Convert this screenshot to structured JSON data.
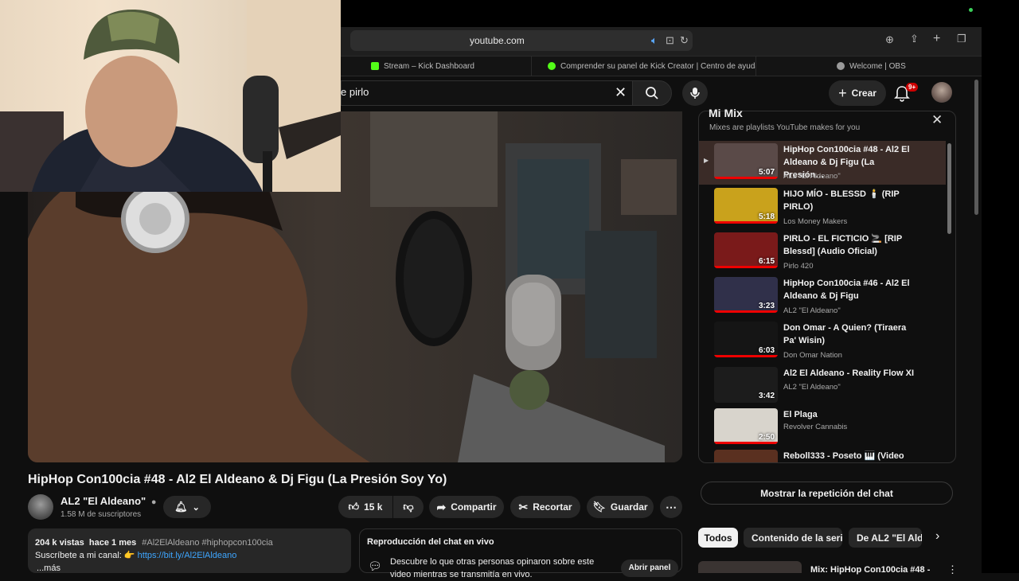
{
  "browser": {
    "url": "youtube.com",
    "tabs": [
      {
        "label": "Stream – Kick Dashboard",
        "color": "#53fc18"
      },
      {
        "label": "Comprender su panel de Kick Creator | Centro de ayuda...",
        "color": "#53fc18"
      },
      {
        "label": "Welcome | OBS",
        "color": "#9a9a9a"
      }
    ]
  },
  "header": {
    "search_value": "e pirlo",
    "create_label": "Crear",
    "notif_badge": "9+"
  },
  "video": {
    "title": "HipHop Con100cia #48 - Al2 El Aldeano & Dj Figu (La Presión Soy Yo)",
    "channel_name": "AL2 \"El Aldeano\"",
    "subscribers": "1.58 M de suscriptores",
    "likes": "15 k",
    "share_label": "Compartir",
    "clip_label": "Recortar",
    "save_label": "Guardar"
  },
  "description": {
    "stats": "204 k vistas  hace 1 mes",
    "hashtags": "#Al2ElAldeano #hiphopcon100cia",
    "subscribe_text": "Suscríbete a mi canal: 👉",
    "link": "https://bit.ly/Al2ElAldeano",
    "more": "...más"
  },
  "live_chat": {
    "title": "Reproducción del chat en vivo",
    "text": "Descubre lo que otras personas opinaron sobre este video mientras se transmitía en vivo.",
    "open_label": "Abrir panel"
  },
  "playlist": {
    "title": "Mi Mix",
    "subtitle": "Mixes are playlists YouTube makes for you",
    "items": [
      {
        "title": "HipHop Con100cia #48 - Al2 El Aldeano & Dj Figu (La Presión…",
        "channel": "AL2 \"El Aldeano\"",
        "duration": "5:07",
        "thumb": "#5a4a48"
      },
      {
        "title": "HIJO MÍO - BLESSD 🕯️ (RIP PIRLO)",
        "channel": "Los Money Makers",
        "duration": "5:18",
        "thumb": "#c9a21c"
      },
      {
        "title": "PIRLO - EL FICTICIO 🚬 [RIP Blessd] (Audio Oficial)",
        "channel": "Pirlo 420",
        "duration": "6:15",
        "thumb": "#7a1a1a"
      },
      {
        "title": "HipHop Con100cia #46 - Al2 El Aldeano & Dj Figu",
        "channel": "AL2 \"El Aldeano\"",
        "duration": "3:23",
        "thumb": "#30304a"
      },
      {
        "title": "Don Omar - A Quien? (Tiraera Pa' Wisin)",
        "channel": "Don Omar Nation",
        "duration": "6:03",
        "thumb": "#151515"
      },
      {
        "title": "Al2 El Aldeano - Reality Flow XI",
        "channel": "AL2 \"El Aldeano\"",
        "duration": "3:42",
        "thumb": "#1c1c1c"
      },
      {
        "title": "El Plaga",
        "channel": "Revolver Cannabis",
        "duration": "2:50",
        "thumb": "#d8d4cc"
      },
      {
        "title": "Reboll333 - Poseto 🎹 (Video",
        "channel": "",
        "duration": "",
        "thumb": "#5a3020"
      }
    ]
  },
  "replay_label": "Mostrar la repetición del chat",
  "chips": [
    "Todos",
    "Contenido de la serie",
    "De AL2 \"El Aldeano\""
  ],
  "next_video_title": "Mix: HipHop Con100cia #48 -"
}
